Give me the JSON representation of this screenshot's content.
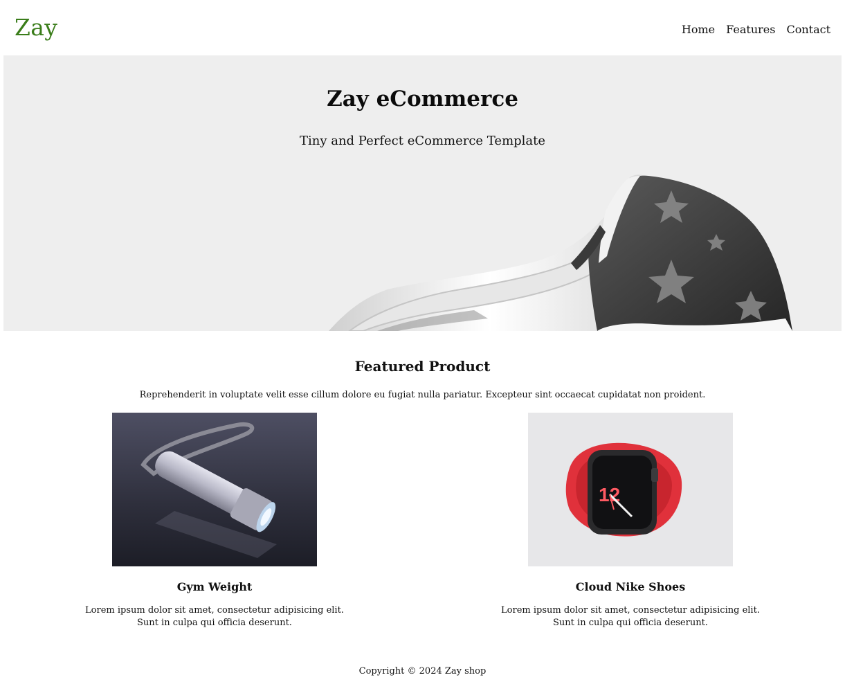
{
  "header": {
    "brand": "Zay",
    "nav": [
      {
        "label": "Home"
      },
      {
        "label": "Features"
      },
      {
        "label": "Contact"
      }
    ]
  },
  "hero": {
    "title": "Zay eCommerce",
    "subtitle": "Tiny and Perfect eCommerce Template"
  },
  "featured": {
    "title": "Featured Product",
    "description": "Reprehenderit in voluptate velit esse cillum dolore eu fugiat nulla pariatur. Excepteur sint occaecat cupidatat non proident.",
    "products": [
      {
        "name": "Gym Weight",
        "text": "Lorem ipsum dolor sit amet, consectetur adipisicing elit. Sunt in culpa qui officia deserunt."
      },
      {
        "name": "Cloud Nike Shoes",
        "text": "Lorem ipsum dolor sit amet, consectetur adipisicing elit. Sunt in culpa qui officia deserunt."
      }
    ]
  },
  "footer": {
    "copyright": "Copyright © 2024 Zay shop"
  },
  "colors": {
    "brand": "#3a7d1a",
    "hero_bg": "#eeeeee"
  }
}
